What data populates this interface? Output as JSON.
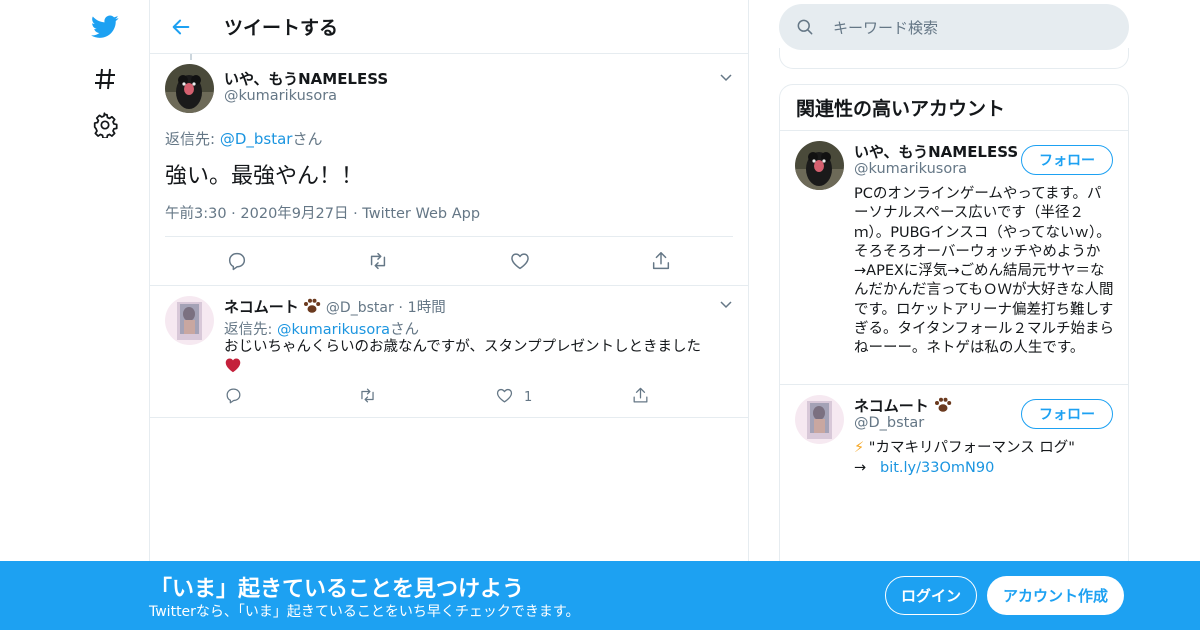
{
  "colors": {
    "accent": "#1da1f2",
    "link": "#1b95e0",
    "heart": "#c4213b",
    "border": "#e6ecf0",
    "muted": "#657786"
  },
  "nav": {
    "icons": [
      "twitter-logo-icon",
      "hashtag-icon",
      "gear-icon"
    ]
  },
  "header": {
    "title": "ツイートする"
  },
  "tweet": {
    "name": "いや、もうNAMELESS",
    "handle": "@kumarikusora",
    "reply_prefix": "返信先: ",
    "reply_to": "@D_bstar",
    "reply_suffix": "さん",
    "text": "強い。最強やん！！",
    "time": "午前3:30",
    "date": "2020年9月27日",
    "client": "Twitter Web App",
    "sep": "·"
  },
  "reply": {
    "name": "ネコムート",
    "handle": "@D_bstar",
    "sep": "·",
    "time": "1時間",
    "reply_prefix": "返信先: ",
    "reply_to": "@kumarikusora",
    "reply_suffix": "さん",
    "text": "おじいちゃんくらいのお歳なんですが、スタンププレゼントしときました",
    "like_count": "1"
  },
  "search": {
    "placeholder": "キーワード検索"
  },
  "related": {
    "title": "関連性の高いアカウント",
    "accounts": [
      {
        "name": "いや、もうNAMELESS",
        "handle": "@kumarikusora",
        "follow": "フォロー",
        "bio": "PCのオンラインゲームやってます。パーソナルスペース広いです（半径２ｍ）。PUBGインスコ（やってないｗ）。そろそろオーバーウォッチやめようか→APEXに浮気→ごめん結局元サヤ＝なんだかんだ言ってもＯＷが大好きな人間です。ロケットアリーナ偏差打ち難しすぎる。タイタンフォール２マルチ始まらねーーー。ネトゲは私の人生です。"
      },
      {
        "name": "ネコムート",
        "handle": "@D_bstar",
        "follow": "フォロー",
        "bio_emoji": "⚡",
        "bio_line1": "\"カマキリパフォーマンス ログ\"",
        "bio_arrow": "→",
        "bio_link": "bit.ly/33OmN90"
      }
    ]
  },
  "banner": {
    "title": "「いま」起きていることを見つけよう",
    "subtitle": "Twitterなら、「いま」起きていることをいち早くチェックできます。",
    "login": "ログイン",
    "signup": "アカウント作成"
  }
}
